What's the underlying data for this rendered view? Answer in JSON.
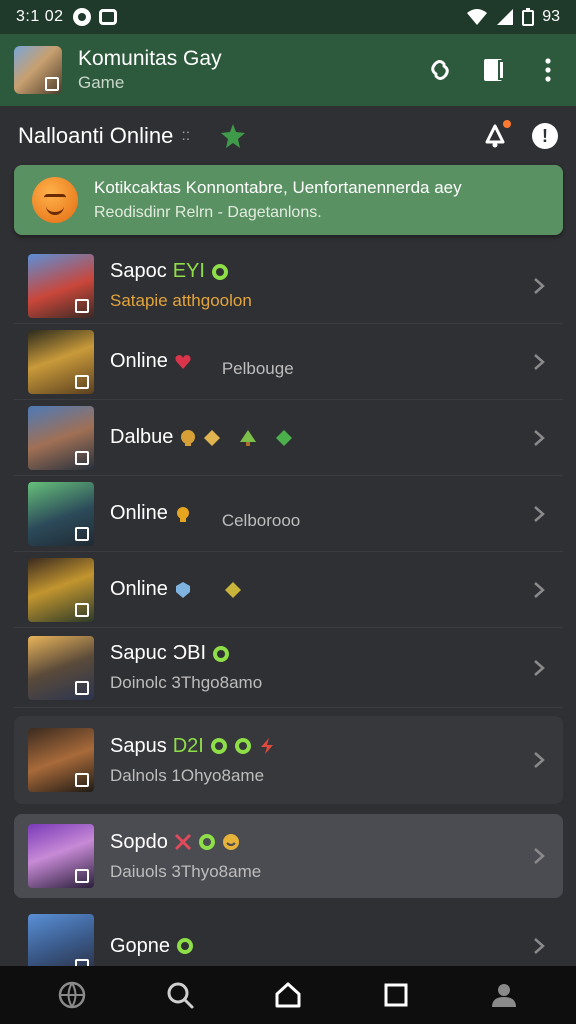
{
  "status_bar": {
    "time": "3:1 02",
    "right_text": "93",
    "icons": [
      "circle-icon",
      "square-icon",
      "wifi-icon",
      "signal-icon",
      "battery-icon"
    ]
  },
  "app_bar": {
    "title": "Komunitas Gay",
    "subtitle": "Game",
    "actions": [
      "link-icon",
      "book-icon",
      "more-vert-icon"
    ],
    "color": "#2d5a3d"
  },
  "section": {
    "title": "Nalloanti Online",
    "dots": "::",
    "actions": [
      "bell-icon",
      "info-icon"
    ]
  },
  "banner": {
    "title": "Kotikcaktas Konnontabre, Uenfortanennerda aey",
    "subtitle": "Reodisdinr Relrn - Dagetanlons.",
    "color": "#5a9163"
  },
  "rows": [
    {
      "name": "Sapoc",
      "tag": "EYI",
      "sub": "Satapie atthgoolon",
      "sub_color": "#e3a43c",
      "sub_inline": false,
      "style": "flat"
    },
    {
      "name": "Online",
      "tag": "",
      "sub": "Pelbouge",
      "sub_color": "#bdbdbd",
      "sub_inline": true,
      "style": "flat"
    },
    {
      "name": "Dalbue",
      "tag": "",
      "sub": "",
      "sub_color": "#bdbdbd",
      "sub_inline": false,
      "style": "flat"
    },
    {
      "name": "Online",
      "tag": "",
      "sub": "Celborooo",
      "sub_color": "#bdbdbd",
      "sub_inline": true,
      "style": "flat"
    },
    {
      "name": "Online",
      "tag": "",
      "sub": "",
      "sub_color": "#bdbdbd",
      "sub_inline": false,
      "style": "flat"
    },
    {
      "name": "Sapuc",
      "tag": "ƆBI",
      "sub": "Doinolc 3Thgo8amo",
      "sub_color": "#bdbdbd",
      "sub_inline": false,
      "style": "flat"
    },
    {
      "name": "Sapus",
      "tag": "D2I",
      "sub": "Dalnols 1Ohyo8ame",
      "sub_color": "#bdbdbd",
      "sub_inline": false,
      "style": "card"
    },
    {
      "name": "Sopdo",
      "tag": "",
      "sub": "Daiuols 3Thyo8ame",
      "sub_color": "#bdbdbd",
      "sub_inline": false,
      "style": "card-hl"
    },
    {
      "name": "Gopne",
      "tag": "",
      "sub": "",
      "sub_color": "#bdbdbd",
      "sub_inline": false,
      "style": "flat"
    }
  ],
  "nav": [
    "globe-icon",
    "search-icon",
    "home-icon",
    "recents-icon",
    "profile-icon"
  ]
}
